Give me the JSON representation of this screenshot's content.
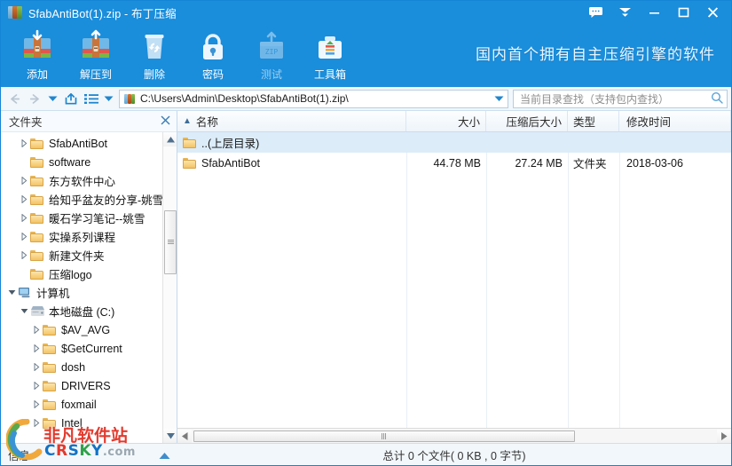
{
  "window": {
    "title": "SfabAntiBot(1).zip - 布丁压缩",
    "app_icon": "archive-icon",
    "controls": [
      {
        "name": "feedback-button",
        "icon": "speech-bubble-icon",
        "label": ""
      },
      {
        "name": "collapse-button",
        "icon": "chevron-down-icon",
        "label": ""
      },
      {
        "name": "minimize-button",
        "icon": "minimize-icon",
        "label": ""
      },
      {
        "name": "maximize-button",
        "icon": "maximize-icon",
        "label": ""
      },
      {
        "name": "close-button",
        "icon": "close-icon",
        "label": ""
      }
    ],
    "accent_color": "#1a8ddb"
  },
  "toolbar": {
    "banner_text": "国内首个拥有自主压缩引擎的软件",
    "buttons": [
      {
        "label": "添加",
        "icon": "archive-add-icon",
        "disabled": false
      },
      {
        "label": "解压到",
        "icon": "archive-extract-icon",
        "disabled": false
      },
      {
        "label": "删除",
        "icon": "trash-icon",
        "disabled": false
      },
      {
        "label": "密码",
        "icon": "lock-icon",
        "disabled": false
      },
      {
        "label": "测试",
        "icon": "zip-test-icon",
        "disabled": true
      },
      {
        "label": "工具箱",
        "icon": "toolbox-icon",
        "disabled": false
      }
    ]
  },
  "navbar": {
    "back_icon": "arrow-left-icon",
    "forward_icon": "arrow-right-icon",
    "history_icon": "chevron-down-icon",
    "up_icon": "up-box-icon",
    "view_icon": "list-view-icon",
    "view_caret_icon": "chevron-down-icon",
    "address": "C:\\Users\\Admin\\Desktop\\SfabAntiBot(1).zip\\",
    "address_caret_icon": "chevron-down-icon",
    "search_placeholder": "当前目录查找（支持包内查找）",
    "search_value": "",
    "search_icon": "search-icon"
  },
  "sidebar": {
    "title": "文件夹",
    "close_icon": "close-icon",
    "tree": [
      {
        "label": "SfabAntiBot",
        "indent": 1,
        "expandable": true,
        "icon": "folder-icon"
      },
      {
        "label": "software",
        "indent": 1,
        "expandable": false,
        "icon": "folder-icon"
      },
      {
        "label": "东方软件中心",
        "indent": 1,
        "expandable": true,
        "icon": "folder-icon"
      },
      {
        "label": "给知乎盆友的分享-姚雪",
        "indent": 1,
        "expandable": true,
        "icon": "folder-icon"
      },
      {
        "label": "暖石学习笔记--姚雪",
        "indent": 1,
        "expandable": true,
        "icon": "folder-icon"
      },
      {
        "label": "实操系列课程",
        "indent": 1,
        "expandable": true,
        "icon": "folder-icon"
      },
      {
        "label": "新建文件夹",
        "indent": 1,
        "expandable": true,
        "icon": "folder-icon"
      },
      {
        "label": "压缩logo",
        "indent": 1,
        "expandable": false,
        "icon": "folder-icon"
      },
      {
        "label": "计算机",
        "indent": 0,
        "expandable": true,
        "expanded": true,
        "icon": "computer-icon"
      },
      {
        "label": "本地磁盘 (C:)",
        "indent": 1,
        "expandable": true,
        "expanded": true,
        "icon": "drive-icon"
      },
      {
        "label": "$AV_AVG",
        "indent": 2,
        "expandable": true,
        "icon": "folder-icon"
      },
      {
        "label": "$GetCurrent",
        "indent": 2,
        "expandable": true,
        "icon": "folder-icon"
      },
      {
        "label": "dosh",
        "indent": 2,
        "expandable": true,
        "icon": "folder-icon"
      },
      {
        "label": "DRIVERS",
        "indent": 2,
        "expandable": true,
        "icon": "folder-icon"
      },
      {
        "label": "foxmail",
        "indent": 2,
        "expandable": true,
        "icon": "folder-icon"
      },
      {
        "label": "Intel",
        "indent": 2,
        "expandable": true,
        "icon": "folder-icon"
      }
    ],
    "scroll_up_icon": "triangle-up-icon",
    "scroll_down_icon": "triangle-down-icon"
  },
  "filelist": {
    "sort_icon": "arrow-up-icon",
    "columns": [
      {
        "key": "name",
        "label": "名称"
      },
      {
        "key": "size",
        "label": "大小"
      },
      {
        "key": "csize",
        "label": "压缩后大小"
      },
      {
        "key": "type",
        "label": "类型"
      },
      {
        "key": "time",
        "label": "修改时间"
      }
    ],
    "rows": [
      {
        "name": "..(上层目录)",
        "size": "",
        "csize": "",
        "type": "",
        "time": "",
        "selected": true,
        "icon": "folder-up-icon"
      },
      {
        "name": "SfabAntiBot",
        "size": "44.78 MB",
        "csize": "27.24 MB",
        "type": "文件夹",
        "time": "2018-03-06",
        "selected": false,
        "icon": "folder-icon"
      }
    ],
    "hscroll_left_icon": "triangle-left-icon",
    "hscroll_right_icon": "triangle-right-icon"
  },
  "statusbar": {
    "left_text": "信息",
    "collapse_icon": "triangle-up-icon",
    "summary": "总计 0 个文件( 0 KB , 0 字节)"
  },
  "watermark": {
    "line1": "非凡软件站",
    "brand_c": "C",
    "brand_r": "R",
    "brand_s": "S",
    "brand_k": "K",
    "brand_y": "Y",
    "brand_com": ".com"
  }
}
